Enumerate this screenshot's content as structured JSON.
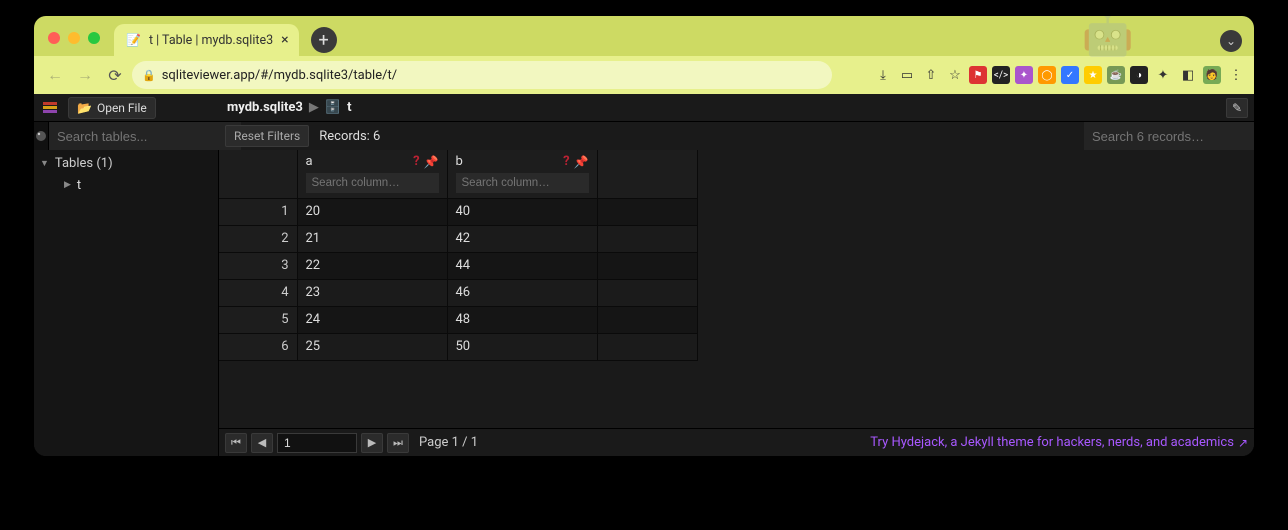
{
  "browser": {
    "tab_title": "t | Table | mydb.sqlite3",
    "url": "sqliteviewer.app/#/mydb.sqlite3/table/t/"
  },
  "toolbar": {
    "open_file": "Open File",
    "breadcrumb_db": "mydb.sqlite3",
    "breadcrumb_table": "t"
  },
  "row2": {
    "search_tables_placeholder": "Search tables...",
    "reset_filters": "Reset Filters",
    "records_label": "Records: 6",
    "search_records_placeholder": "Search 6 records…"
  },
  "sidebar": {
    "tables_header": "Tables (1)",
    "items": [
      {
        "name": "t"
      }
    ]
  },
  "grid": {
    "columns": [
      {
        "name": "a",
        "filter_placeholder": "Search column…"
      },
      {
        "name": "b",
        "filter_placeholder": "Search column…"
      }
    ],
    "rows": [
      {
        "n": "1",
        "a": "20",
        "b": "40"
      },
      {
        "n": "2",
        "a": "21",
        "b": "42"
      },
      {
        "n": "3",
        "a": "22",
        "b": "44"
      },
      {
        "n": "4",
        "a": "23",
        "b": "46"
      },
      {
        "n": "5",
        "a": "24",
        "b": "48"
      },
      {
        "n": "6",
        "a": "25",
        "b": "50"
      }
    ]
  },
  "pager": {
    "page_input": "1",
    "page_text": "Page 1 / 1",
    "promo": "Try Hydejack, a Jekyll theme for hackers, nerds, and academics"
  }
}
